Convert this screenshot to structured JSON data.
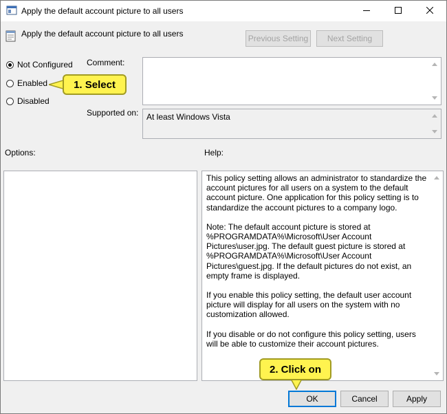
{
  "window": {
    "title": "Apply the default account picture to all users",
    "controls": {
      "minimize_icon": "minimize-icon",
      "maximize_icon": "maximize-icon",
      "close_icon": "close-icon"
    }
  },
  "header": {
    "policy_title": "Apply the default account picture to all users",
    "previous_label": "Previous Setting",
    "next_label": "Next Setting"
  },
  "state": {
    "options": [
      "Not Configured",
      "Enabled",
      "Disabled"
    ],
    "selected": "Not Configured"
  },
  "comment": {
    "label": "Comment:",
    "value": ""
  },
  "supported": {
    "label": "Supported on:",
    "value": "At least Windows Vista"
  },
  "options_panel": {
    "label": "Options:"
  },
  "help_panel": {
    "label": "Help:",
    "paragraphs": [
      "This policy setting allows an administrator to standardize the account pictures for all users on a system to the default account picture. One application for this policy setting is to standardize the account pictures to a company logo.",
      "Note: The default account picture is stored at %PROGRAMDATA%\\Microsoft\\User Account Pictures\\user.jpg. The default guest picture is stored at %PROGRAMDATA%\\Microsoft\\User Account Pictures\\guest.jpg. If the default pictures do not exist, an empty frame is displayed.",
      "If you enable this policy setting, the default user account picture will display for all users on the system with no customization allowed.",
      "If you disable or do not configure this policy setting, users will be able to customize their account pictures."
    ]
  },
  "buttons": {
    "ok": "OK",
    "cancel": "Cancel",
    "apply": "Apply"
  },
  "callouts": {
    "step1": "1. Select",
    "step2": "2. Click on"
  },
  "colors": {
    "callout_fill": "#fff34f",
    "default_button_border": "#0078d7"
  }
}
